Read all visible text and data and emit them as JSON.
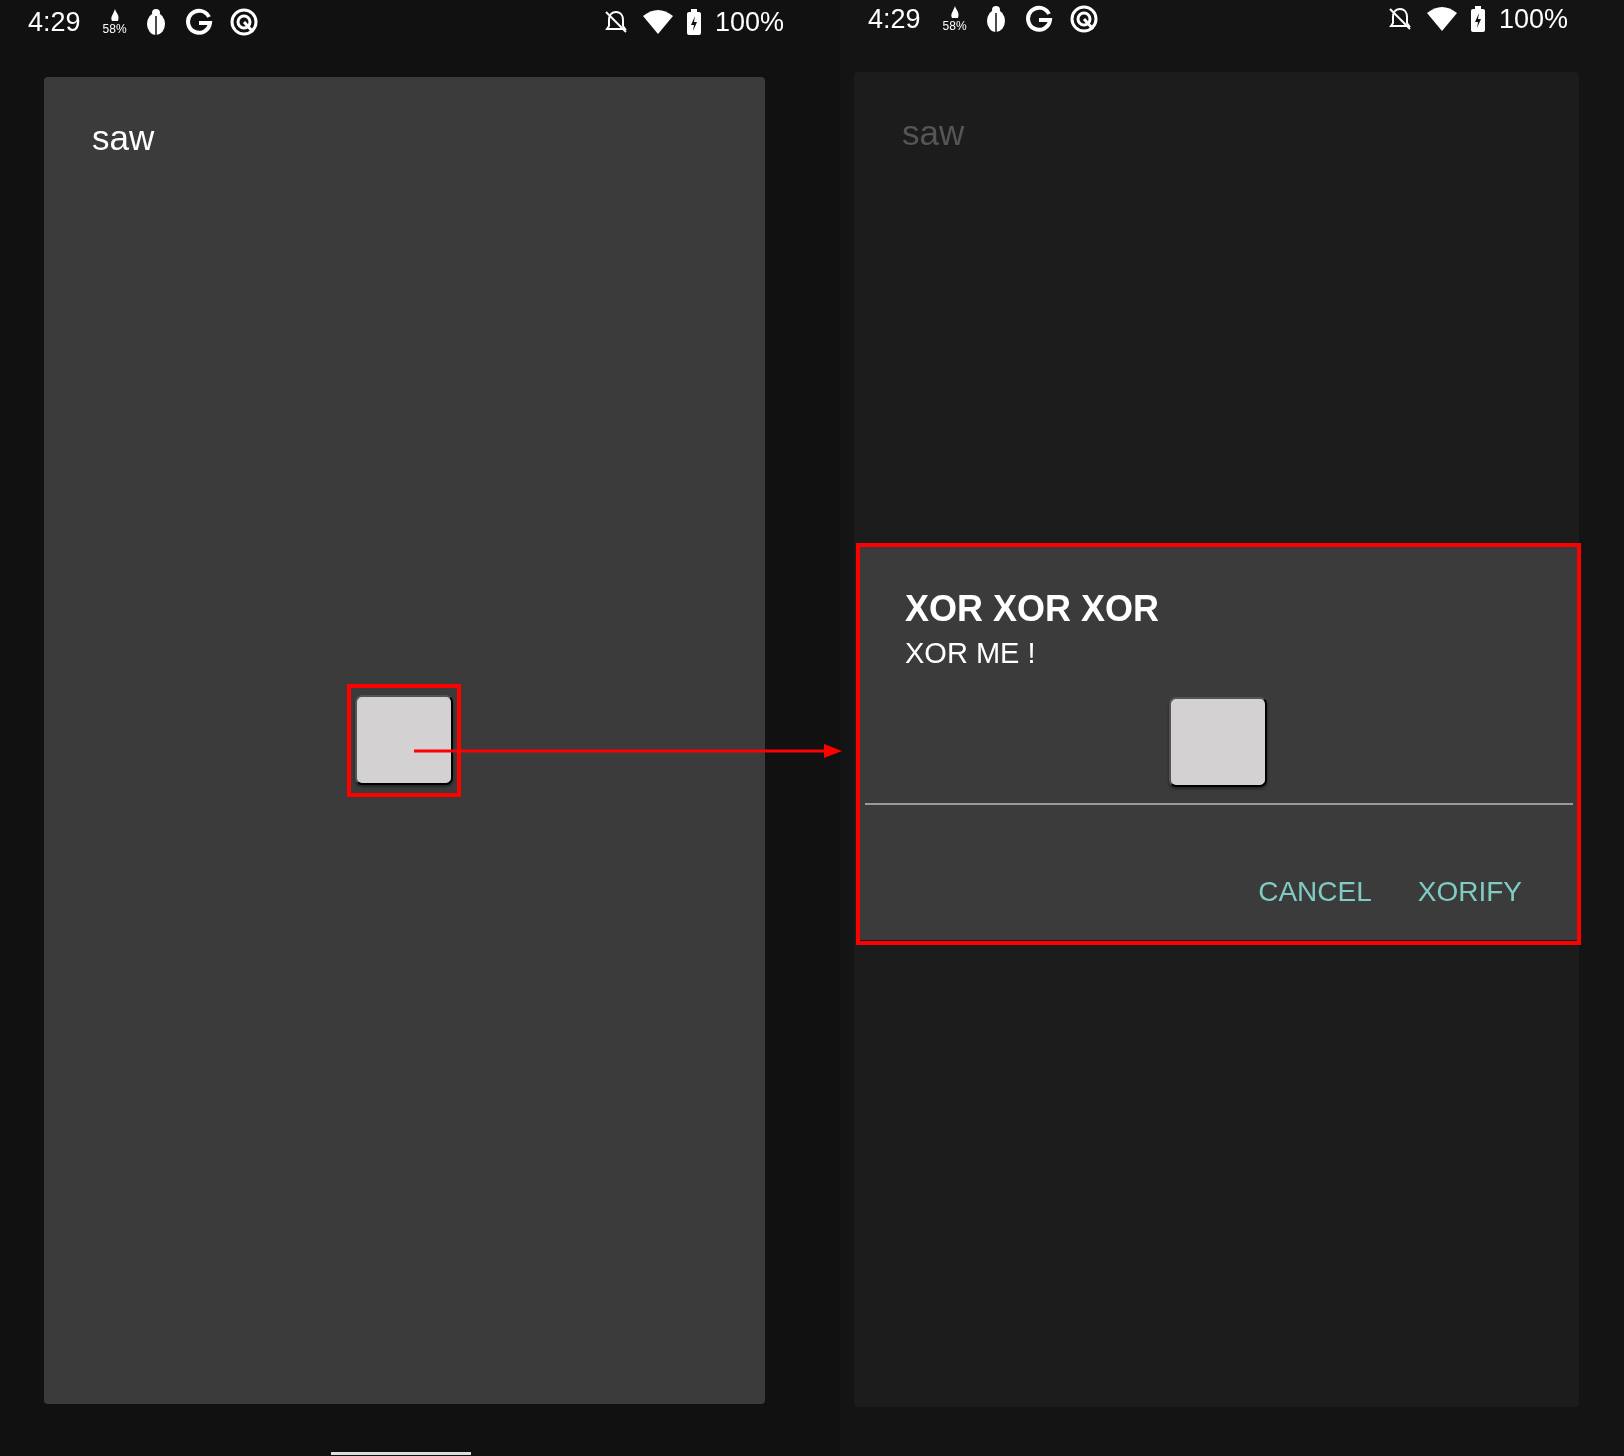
{
  "screens": [
    {
      "status_bar": {
        "time": "4:29",
        "cpu": "58%",
        "battery": "100%"
      },
      "app_title": "saw",
      "dimmed": false
    },
    {
      "status_bar": {
        "time": "4:29",
        "cpu": "58%",
        "battery": "100%"
      },
      "app_title": "saw",
      "dimmed": true,
      "dialog": {
        "title": "XOR XOR XOR",
        "message": "XOR ME !",
        "buttons": [
          "CANCEL",
          "XORIFY"
        ]
      }
    }
  ]
}
